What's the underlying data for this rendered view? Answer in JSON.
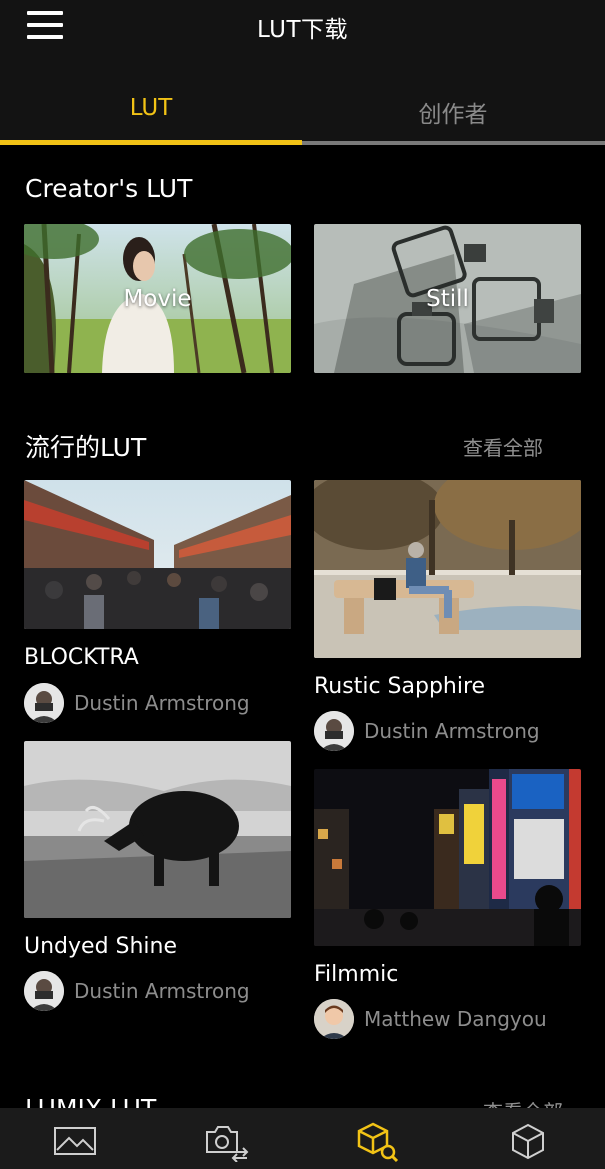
{
  "header": {
    "title": "LUT下载",
    "menu_icon": "hamburger-menu-icon"
  },
  "tabs": [
    {
      "label": "LUT",
      "active": true
    },
    {
      "label": "创作者",
      "active": false
    }
  ],
  "creators_section": {
    "title": "Creator's LUT",
    "cards": [
      {
        "label": "Movie"
      },
      {
        "label": "Still"
      }
    ]
  },
  "popular_section": {
    "title": "流行的LUT",
    "see_all": "查看全部",
    "items": [
      {
        "name": "BLOCKTRA",
        "author": "Dustin Armstrong"
      },
      {
        "name": "Rustic Sapphire",
        "author": "Dustin Armstrong"
      },
      {
        "name": "Undyed Shine",
        "author": "Dustin Armstrong"
      },
      {
        "name": "Filmmic",
        "author": "Matthew Dangyou"
      }
    ]
  },
  "next_section": {
    "title": "LUMIX LUT",
    "see_all": "查看全部"
  },
  "bottom_nav": {
    "items": [
      {
        "icon": "gallery-icon",
        "active": false
      },
      {
        "icon": "camera-transfer-icon",
        "active": false
      },
      {
        "icon": "lut-search-icon",
        "active": true
      },
      {
        "icon": "cube-icon",
        "active": false
      }
    ]
  },
  "colors": {
    "accent": "#f2c316",
    "background": "#000000",
    "bar": "#131313",
    "muted_text": "#8d8d8d"
  }
}
